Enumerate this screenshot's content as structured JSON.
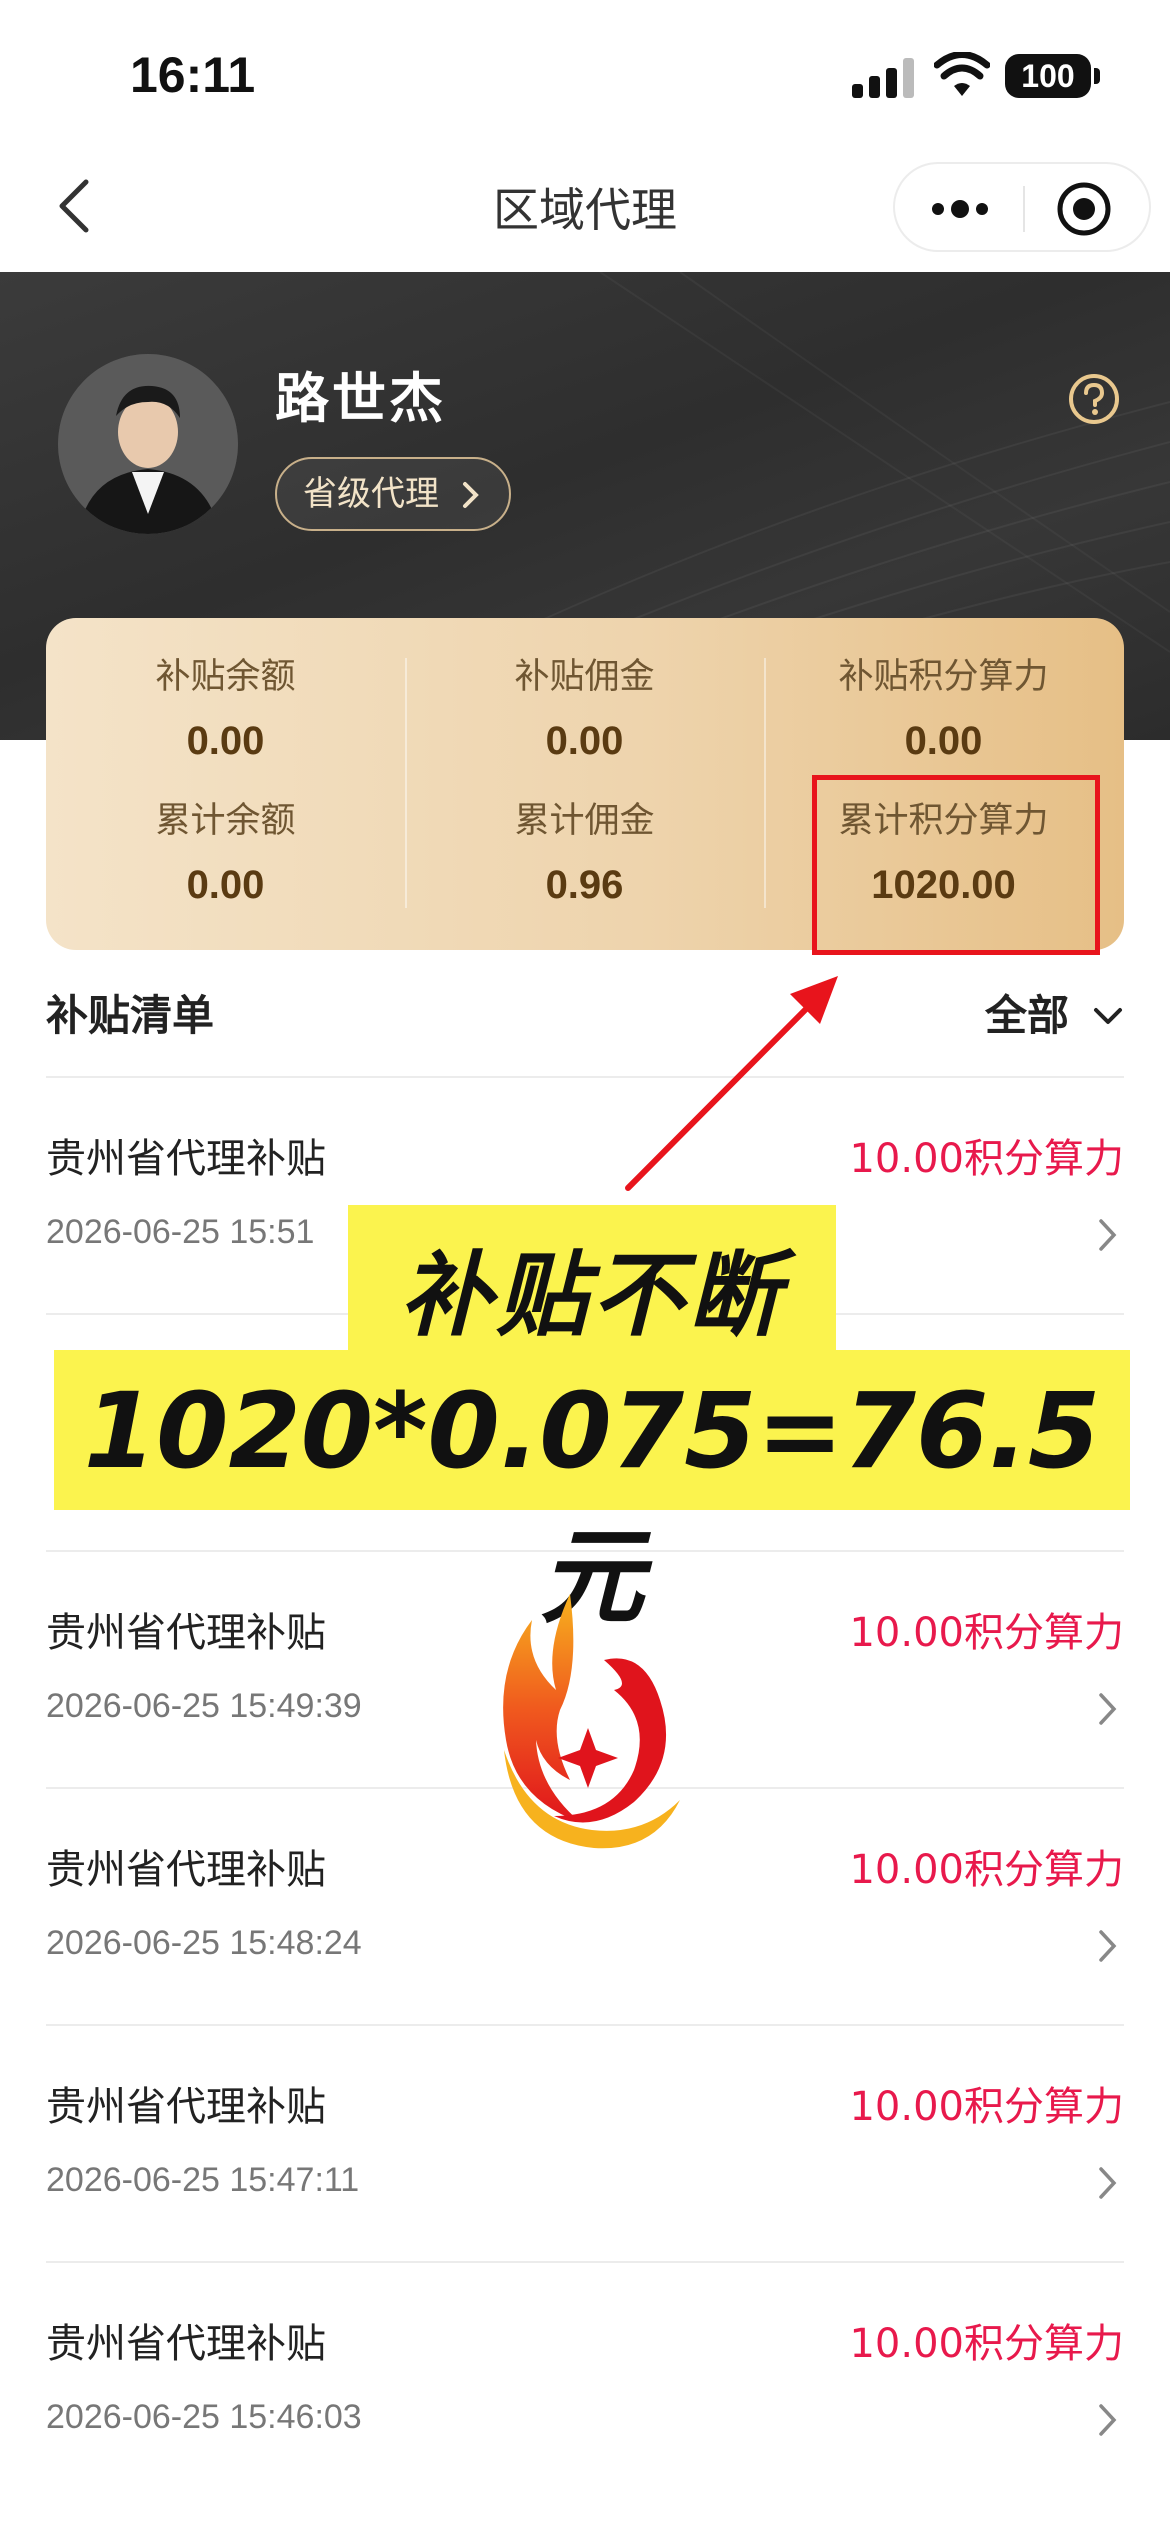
{
  "status_bar": {
    "time": "16:11",
    "battery": "100"
  },
  "nav": {
    "title": "区域代理"
  },
  "profile": {
    "name": "路世杰",
    "level": "省级代理"
  },
  "stats": [
    {
      "label": "补贴余额",
      "value": "0.00"
    },
    {
      "label": "补贴佣金",
      "value": "0.00"
    },
    {
      "label": "补贴积分算力",
      "value": "0.00"
    },
    {
      "label": "累计余额",
      "value": "0.00"
    },
    {
      "label": "累计佣金",
      "value": "0.96"
    },
    {
      "label": "累计积分算力",
      "value": "1020.00"
    }
  ],
  "list": {
    "title": "补贴清单",
    "filter": "全部",
    "items": [
      {
        "title": "贵州省代理补贴",
        "amount": "10.00积分算力",
        "time": "2026-06-25 15:51"
      },
      {
        "title": "",
        "amount": "",
        "time": ""
      },
      {
        "title": "贵州省代理补贴",
        "amount": "10.00积分算力",
        "time": "2026-06-25 15:49:39"
      },
      {
        "title": "贵州省代理补贴",
        "amount": "10.00积分算力",
        "time": "2026-06-25 15:48:24"
      },
      {
        "title": "贵州省代理补贴",
        "amount": "10.00积分算力",
        "time": "2026-06-25 15:47:11"
      },
      {
        "title": "贵州省代理补贴",
        "amount": "10.00积分算力",
        "time": "2026-06-25 15:46:03"
      }
    ]
  },
  "promo": {
    "line1": "补贴不断",
    "line2": "1020*0.075=76.5元"
  },
  "colors": {
    "accent_red": "#e8194c",
    "highlight_red": "#e8141c",
    "promo_yellow": "#fbf34e",
    "header_dark": "#333333",
    "card_gold": "#eed4ad"
  },
  "icons": [
    "back-icon",
    "more-icon",
    "close-target-icon",
    "help-icon",
    "chevron-right-icon",
    "chevron-down-icon",
    "signal-icon",
    "wifi-icon",
    "battery-icon",
    "flame-logo-icon"
  ]
}
